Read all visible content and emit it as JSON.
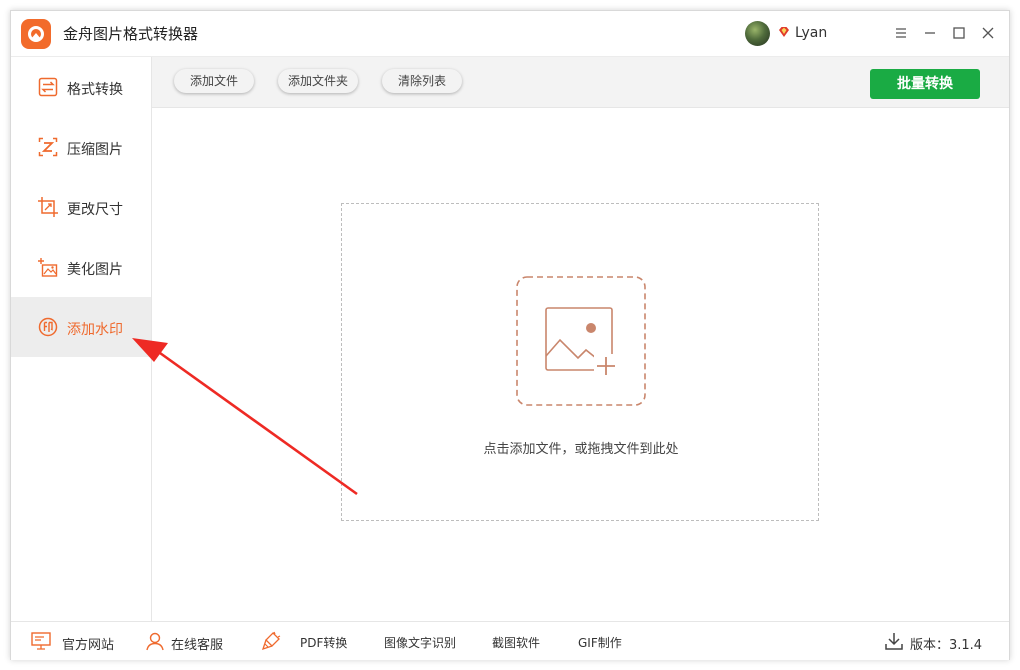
{
  "app": {
    "title": "金舟图片格式转换器"
  },
  "user": {
    "name": "Lyan",
    "avatar_icon": "user-avatar",
    "vip_icon": "gem-icon"
  },
  "window_controls": [
    "menu-icon",
    "minimize-icon",
    "maximize-icon",
    "close-icon"
  ],
  "sidebar": {
    "items": [
      {
        "label": "格式转换",
        "icon": "convert-icon",
        "active": false
      },
      {
        "label": "压缩图片",
        "icon": "compress-icon",
        "active": false
      },
      {
        "label": "更改尺寸",
        "icon": "resize-icon",
        "active": false
      },
      {
        "label": "美化图片",
        "icon": "beautify-icon",
        "active": false
      },
      {
        "label": "添加水印",
        "icon": "watermark-icon",
        "active": true
      }
    ]
  },
  "toolbar": {
    "add_file": "添加文件",
    "add_folder": "添加文件夹",
    "clear_list": "清除列表",
    "batch_convert": "批量转换"
  },
  "dropzone": {
    "icon": "add-image-icon",
    "hint": "点击添加文件，或拖拽文件到此处"
  },
  "footer": {
    "items": [
      {
        "label": "官方网站",
        "icon": "monitor-icon"
      },
      {
        "label": "在线客服",
        "icon": "support-icon"
      },
      {
        "label": "PDF转换",
        "icon": "brush-icon"
      },
      {
        "label": "图像文字识别"
      },
      {
        "label": "截图软件"
      },
      {
        "label": "GIF制作"
      }
    ],
    "version": "版本：3.1.4",
    "version_icon": "download-icon"
  },
  "colors": {
    "accent": "#ef6a2e",
    "primary": "#1aab44",
    "annotation": "#ee2a24"
  }
}
